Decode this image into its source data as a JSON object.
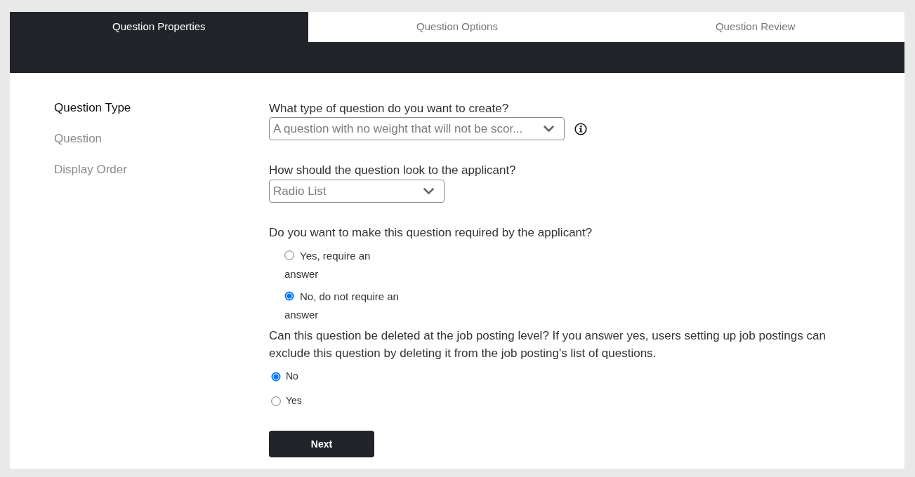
{
  "tabs": [
    {
      "label": "Question Properties",
      "selected": true
    },
    {
      "label": "Question Options",
      "selected": false
    },
    {
      "label": "Question Review",
      "selected": false
    }
  ],
  "sidebar": {
    "items": [
      {
        "label": "Question Type",
        "selected": true
      },
      {
        "label": "Question",
        "selected": false
      },
      {
        "label": "Display Order",
        "selected": false
      }
    ]
  },
  "form": {
    "fields": [
      {
        "kind": "select",
        "label": "What type of question do you want to create?",
        "value": "A question with no weight that will not be scor...",
        "info": true
      },
      {
        "kind": "select",
        "label": "How should the question look to the applicant?",
        "value": "Radio List"
      },
      {
        "kind": "radio_group",
        "label": "Do you want to make this question required by the applicant?",
        "options": [
          {
            "label": "Yes, require an answer",
            "selected": false
          },
          {
            "label": "No, do not require an answer",
            "selected": true
          }
        ]
      },
      {
        "kind": "radio_group",
        "label": "Can this question be deleted at the job posting level? If you answer yes, users setting up job postings can exclude this question by deleting it from the job posting's list of questions.",
        "options": [
          {
            "label": "No",
            "selected": true
          },
          {
            "label": "Yes",
            "selected": false
          }
        ]
      }
    ]
  },
  "next_button": "Next"
}
